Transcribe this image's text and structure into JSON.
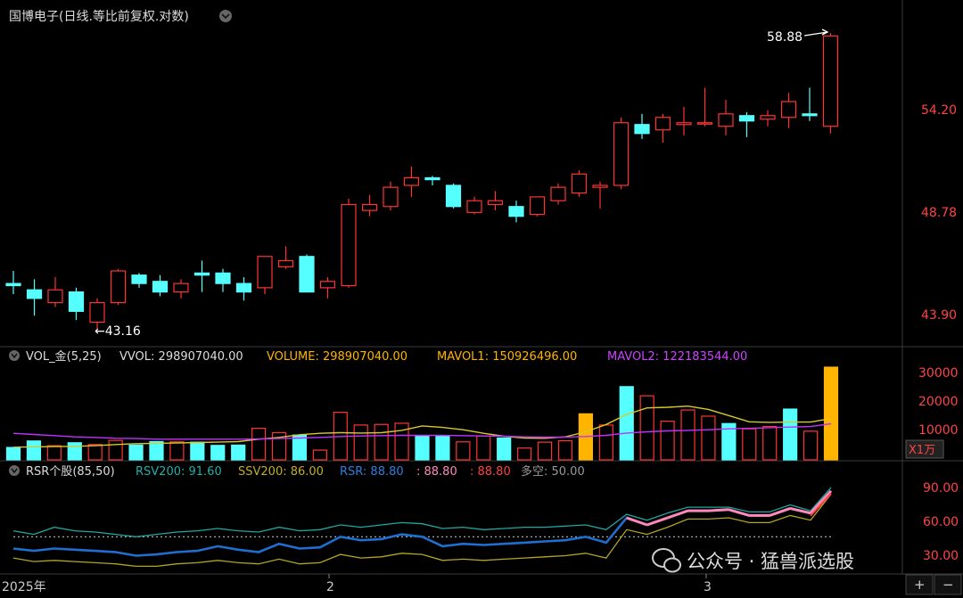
{
  "header": {
    "title": "国博电子(日线.等比前复权.对数)",
    "price_labels": [
      "54.20",
      "48.78",
      "43.90"
    ],
    "price_label_values": [
      54.2,
      48.78,
      43.9
    ],
    "max_marker": "58.88",
    "min_marker": "←43.16"
  },
  "vol_panel": {
    "indicator": "VOL_金(5,25)",
    "vvol": "VVOL: 298907040.00",
    "volume": "VOLUME: 298907040.00",
    "mavol1": "MAVOL1: 150926496.00",
    "mavol2": "MAVOL2: 122183544.00",
    "axis_labels": [
      "30000",
      "20000",
      "10000"
    ],
    "axis_values": [
      30000,
      20000,
      10000
    ],
    "unit_button": "X1万"
  },
  "rsr_panel": {
    "indicator": "RSR个股(85,50)",
    "rsv200": "RSV200: 91.60",
    "ssv200": "SSV200: 86.00",
    "rsr": "RSR: 88.80",
    "v1": ": 88.80",
    "v2": ": 88.80",
    "duokong": "多空: 50.00",
    "axis_labels": [
      "90.00",
      "60.00",
      "30.00"
    ],
    "axis_values": [
      90,
      60,
      30
    ]
  },
  "xaxis": {
    "labels": [
      "2025年",
      "2",
      "3"
    ]
  },
  "controls": {
    "plus": "+",
    "minus": "−"
  },
  "watermark": {
    "text": "公众号 · 猛兽派选股"
  },
  "colors": {
    "up": "#ff3333",
    "down": "#55ffff",
    "gold": "#ffb400",
    "mavol1": "#d7c92a",
    "mavol2": "#c030ff",
    "rsv200": "#1fa7a0",
    "ssv200": "#b3a620",
    "rsr": "#1f6fd0",
    "pink": "#ff88bb",
    "red2": "#ff4040",
    "duokong": "#999999"
  },
  "chart_data": [
    {
      "type": "candlestick",
      "title": "国博电子(日线.等比前复权.对数)",
      "scale": "log",
      "ylim": [
        43.16,
        58.88
      ],
      "x": [
        1,
        2,
        3,
        4,
        5,
        6,
        7,
        8,
        9,
        10,
        11,
        12,
        13,
        14,
        15,
        16,
        17,
        18,
        19,
        20,
        21,
        22,
        23,
        24,
        25,
        26,
        27,
        28,
        29,
        30,
        31,
        32,
        33,
        34,
        35,
        36,
        37,
        38,
        39,
        40
      ],
      "ohlc": [
        [
          45.3,
          45.9,
          44.8,
          45.2
        ],
        [
          45.0,
          45.5,
          43.8,
          44.6
        ],
        [
          44.4,
          45.6,
          44.2,
          45.0
        ],
        [
          44.9,
          45.1,
          43.6,
          44.0
        ],
        [
          43.5,
          44.6,
          43.16,
          44.4
        ],
        [
          44.4,
          46.0,
          44.3,
          45.9
        ],
        [
          45.7,
          45.8,
          45.1,
          45.3
        ],
        [
          45.4,
          45.7,
          44.7,
          44.9
        ],
        [
          44.9,
          45.5,
          44.6,
          45.3
        ],
        [
          45.8,
          46.4,
          44.9,
          45.7
        ],
        [
          45.8,
          46.0,
          44.9,
          45.3
        ],
        [
          45.3,
          45.6,
          44.5,
          44.9
        ],
        [
          45.1,
          46.6,
          44.8,
          46.6
        ],
        [
          46.1,
          47.1,
          46.0,
          46.4
        ],
        [
          46.6,
          46.7,
          44.9,
          44.9
        ],
        [
          45.1,
          45.6,
          44.6,
          45.4
        ],
        [
          45.2,
          49.5,
          45.1,
          49.2
        ],
        [
          48.9,
          49.7,
          48.6,
          49.2
        ],
        [
          49.1,
          50.4,
          48.9,
          50.1
        ],
        [
          50.2,
          51.2,
          49.6,
          50.6
        ],
        [
          50.6,
          50.7,
          50.2,
          50.5
        ],
        [
          50.2,
          50.3,
          49.0,
          49.1
        ],
        [
          48.8,
          49.6,
          48.7,
          49.4
        ],
        [
          49.2,
          49.9,
          48.9,
          49.4
        ],
        [
          49.1,
          49.4,
          48.3,
          48.6
        ],
        [
          48.7,
          49.6,
          48.6,
          49.6
        ],
        [
          49.4,
          50.3,
          49.2,
          50.1
        ],
        [
          49.8,
          51.0,
          49.6,
          50.8
        ],
        [
          50.1,
          50.4,
          49.0,
          50.2
        ],
        [
          50.2,
          53.9,
          50.0,
          53.6
        ],
        [
          53.5,
          54.1,
          52.7,
          53.0
        ],
        [
          53.2,
          54.1,
          52.5,
          53.9
        ],
        [
          53.5,
          54.5,
          52.9,
          53.6
        ],
        [
          53.6,
          55.6,
          53.4,
          53.6
        ],
        [
          53.4,
          54.9,
          52.9,
          54.1
        ],
        [
          54.0,
          54.2,
          52.8,
          53.7
        ],
        [
          53.8,
          54.3,
          53.4,
          54.0
        ],
        [
          53.9,
          55.3,
          53.3,
          54.8
        ],
        [
          54.1,
          55.6,
          53.7,
          54.0
        ],
        [
          53.4,
          58.88,
          53.0,
          58.7
        ]
      ]
    },
    {
      "type": "bar",
      "title": "VOL_金(5,25)",
      "unit": "X1万",
      "x": [
        1,
        2,
        3,
        4,
        5,
        6,
        7,
        8,
        9,
        10,
        11,
        12,
        13,
        14,
        15,
        16,
        17,
        18,
        19,
        20,
        21,
        22,
        23,
        24,
        25,
        26,
        27,
        28,
        29,
        30,
        31,
        32,
        33,
        34,
        35,
        36,
        37,
        38,
        39,
        40
      ],
      "values": [
        4200,
        6400,
        4800,
        5800,
        5200,
        6600,
        5000,
        6200,
        6100,
        6000,
        4900,
        5000,
        10700,
        9200,
        8400,
        3300,
        16100,
        11800,
        12000,
        12400,
        8000,
        8000,
        6100,
        8100,
        7400,
        4000,
        6000,
        6500,
        15600,
        11800,
        24800,
        21700,
        13100,
        16900,
        14800,
        12300,
        10500,
        11300,
        17200,
        9700,
        31400
      ],
      "gold_bars": [
        29,
        41
      ],
      "mavol1": [
        4300,
        4400,
        4500,
        4600,
        4800,
        5200,
        5500,
        5600,
        5700,
        5900,
        6000,
        6200,
        7000,
        7600,
        8500,
        9000,
        9200,
        9100,
        9200,
        10000,
        11500,
        11000,
        10200,
        9000,
        8000,
        7400,
        7300,
        7800,
        9500,
        12000,
        15400,
        17600,
        17800,
        18200,
        17100,
        15000,
        12900,
        12700,
        12800,
        12800,
        14000
      ],
      "mavol2": [
        9000,
        8600,
        8200,
        7800,
        7600,
        7300,
        7200,
        7000,
        7000,
        7000,
        7000,
        7000,
        7100,
        7200,
        7400,
        7600,
        7900,
        8100,
        8200,
        8300,
        8300,
        8300,
        8200,
        8100,
        8000,
        7800,
        7700,
        7700,
        7900,
        8300,
        9100,
        9500,
        9800,
        10000,
        10200,
        10500,
        10700,
        10900,
        11100,
        11300,
        12218
      ]
    },
    {
      "type": "line",
      "title": "RSR个股(85,50)",
      "ylim": [
        20,
        100
      ],
      "x": [
        1,
        2,
        3,
        4,
        5,
        6,
        7,
        8,
        9,
        10,
        11,
        12,
        13,
        14,
        15,
        16,
        17,
        18,
        19,
        20,
        21,
        22,
        23,
        24,
        25,
        26,
        27,
        28,
        29,
        30,
        31,
        32,
        33,
        34,
        35,
        36,
        37,
        38,
        39,
        40
      ],
      "series": [
        {
          "name": "RSV200",
          "values": [
            55,
            52,
            58,
            55,
            54,
            52,
            50,
            52,
            54,
            55,
            57,
            55,
            54,
            58,
            55,
            56,
            60,
            58,
            60,
            62,
            61,
            57,
            58,
            56,
            57,
            58,
            58,
            59,
            60,
            56,
            69,
            64,
            70,
            75,
            75,
            75,
            71,
            71,
            77,
            72,
            91.6
          ]
        },
        {
          "name": "SSV200",
          "values": [
            32,
            29,
            30,
            29,
            28,
            27,
            25,
            25,
            27,
            28,
            30,
            28,
            27,
            31,
            27,
            28,
            35,
            32,
            33,
            36,
            35,
            30,
            31,
            30,
            31,
            32,
            33,
            34,
            36,
            32,
            56,
            52,
            58,
            65,
            65,
            66,
            62,
            62,
            68,
            64,
            86.0
          ]
        },
        {
          "name": "RSR",
          "values": [
            40,
            38,
            40,
            39,
            38,
            37,
            34,
            35,
            37,
            38,
            42,
            39,
            37,
            44,
            40,
            41,
            50,
            47,
            48,
            52,
            50,
            42,
            44,
            43,
            44,
            45,
            46,
            47,
            50,
            45,
            66,
            60,
            66,
            72,
            72,
            73,
            68,
            68,
            74,
            70,
            88.8
          ]
        },
        {
          "name": "多空",
          "values": [
            50,
            50,
            50,
            50,
            50,
            50,
            50,
            50,
            50,
            50,
            50,
            50,
            50,
            50,
            50,
            50,
            50,
            50,
            50,
            50,
            50,
            50,
            50,
            50,
            50,
            50,
            50,
            50,
            50,
            50,
            50,
            50,
            50,
            50,
            50,
            50,
            50,
            50,
            50,
            50,
            50.0
          ]
        }
      ]
    }
  ]
}
